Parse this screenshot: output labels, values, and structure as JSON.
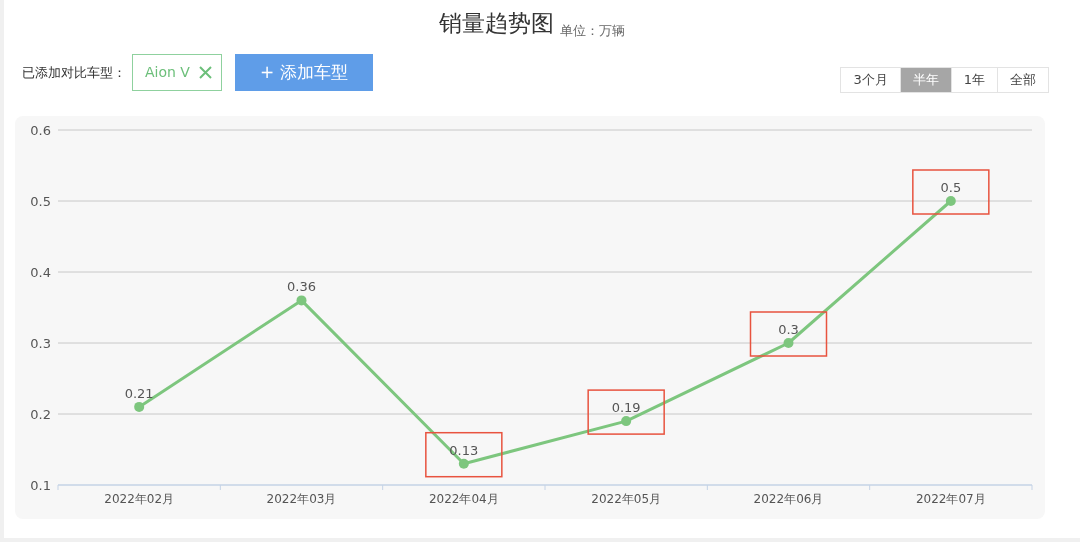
{
  "header": {
    "title": "销量趋势图",
    "unit": "单位：万辆"
  },
  "compare": {
    "label": "已添加对比车型：",
    "tags": [
      {
        "label": "Aion V"
      }
    ],
    "add_button": "+ 添加车型"
  },
  "ranges": [
    {
      "label": "3个月",
      "selected": false
    },
    {
      "label": "半年",
      "selected": true
    },
    {
      "label": "1年",
      "selected": false
    },
    {
      "label": "全部",
      "selected": false
    }
  ],
  "chart": {
    "chart_data": {
      "type": "line",
      "categories": [
        "2022年02月",
        "2022年03月",
        "2022年04月",
        "2022年05月",
        "2022年06月",
        "2022年07月"
      ],
      "series": [
        {
          "color": "#7dc67e",
          "marker": true,
          "values": [
            0.21,
            0.36,
            0.13,
            0.19,
            0.3,
            0.5
          ]
        }
      ],
      "grid": true,
      "ylim": [
        0.1,
        0.6
      ],
      "yticks": [
        0.1,
        0.2,
        0.3,
        0.4,
        0.5,
        0.6
      ],
      "data_labels": true
    },
    "highlights": [
      {
        "highlighted": false
      },
      {
        "highlighted": false
      },
      {
        "highlighted": true
      },
      {
        "highlighted": true
      },
      {
        "highlighted": true
      },
      {
        "highlighted": true
      }
    ]
  }
}
